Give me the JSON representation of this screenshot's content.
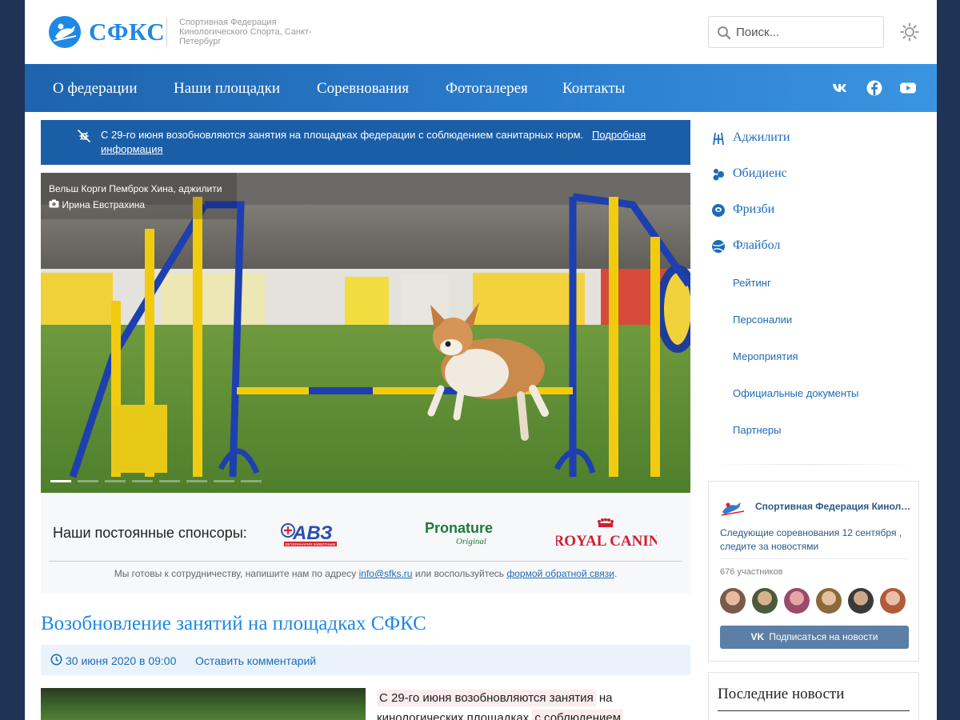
{
  "header": {
    "logo_text": "СФКС",
    "subtitle": "Спортивная Федерация Кинологического Спорта, Санкт-Петербург",
    "search_placeholder": "Поиск...",
    "theme_icon": "sun-icon"
  },
  "nav": {
    "items": [
      "О федерации",
      "Наши площадки",
      "Соревнования",
      "Фотогалерея",
      "Контакты"
    ],
    "social_icons": [
      "vk-icon",
      "facebook-icon",
      "youtube-icon"
    ]
  },
  "notice": {
    "text": "С 29-го июня возобновляются занятия на площадках федерации с соблюдением санитарных норм.",
    "link": "Подробная информация",
    "icon": "no-virus-icon"
  },
  "slider": {
    "caption_title": "Вельш Корги Пемброк Хина, аджилити",
    "caption_author": "Ирина Евстрахина",
    "active_slide": 1,
    "slide_count": 8
  },
  "sponsors": {
    "label": "Наши постоянные спонсоры:",
    "logos": [
      "АВЗ",
      "ВЕТЕРИНАРИЯ ЖИВОТНЫМ",
      "Pronature",
      "Original",
      "ROYAL CANIN"
    ],
    "coop_text_1": "Мы готовы к сотрудничеству, напишите нам по адресу",
    "coop_email": "info@sfks.ru",
    "coop_text_2": "или воспользуйтесь",
    "coop_link": "формой обратной связи",
    "coop_text_3": "."
  },
  "article": {
    "title": "Возобновление занятий на площадках СФКС",
    "date": "30 июня 2020 в 09:00",
    "comment_link": "Оставить комментарий",
    "text_parts": [
      "С 29-го июня возобновляются занятия",
      "на",
      "кинологических площадках",
      "с соблюдением"
    ]
  },
  "sidebar": {
    "sports": [
      {
        "label": "Аджилити",
        "icon": "agility-icon"
      },
      {
        "label": "Обидиенс",
        "icon": "obedience-icon"
      },
      {
        "label": "Фризби",
        "icon": "frisbee-icon"
      },
      {
        "label": "Флайбол",
        "icon": "flyball-icon"
      }
    ],
    "links": [
      "Рейтинг",
      "Персоналии",
      "Мероприятия",
      "Официальные документы",
      "Партнеры"
    ]
  },
  "vk_widget": {
    "group_name": "Спортивная Федерация Кинологического Спорта",
    "post": "Следующие соревнования 12 сентября , следите за новостями",
    "members": "676 участников",
    "subscribe": "Подписаться на новости",
    "vk_glyph": "VK"
  },
  "latest_news": {
    "title": "Последние новости"
  },
  "colors": {
    "brand_blue": "#1e88e5",
    "nav_blue": "#2b7fd0",
    "notice_blue": "#1b5ea8",
    "vk_button": "#5b7fa6",
    "page_bg": "#1f3356"
  }
}
